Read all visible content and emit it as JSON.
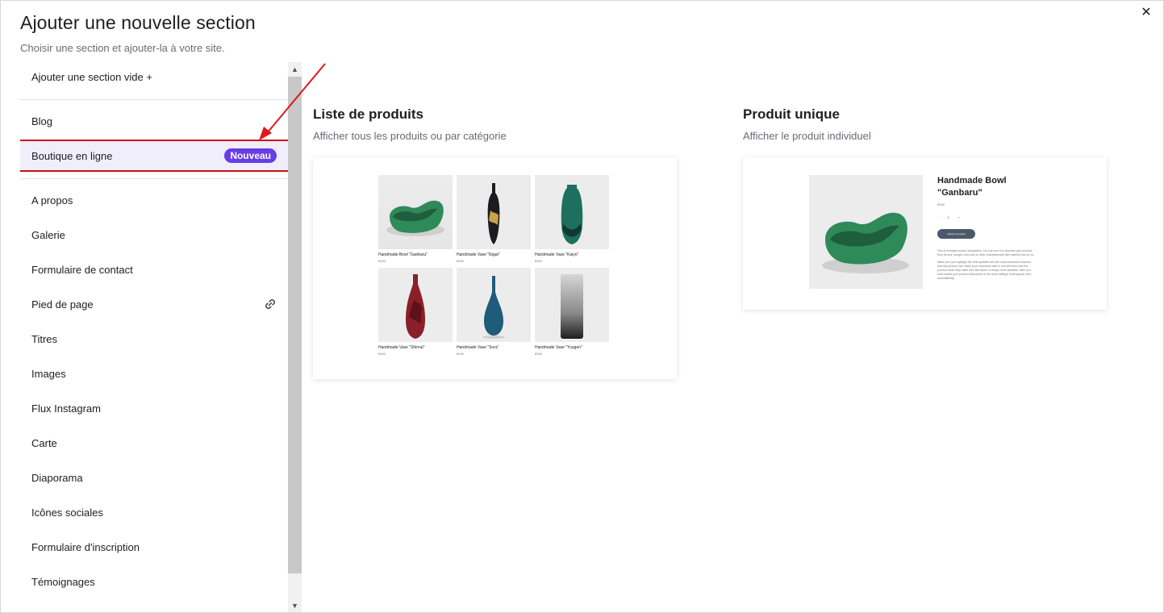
{
  "header": {
    "title": "Ajouter une nouvelle section",
    "subtitle": "Choisir une section et ajouter-la à votre site.",
    "close_glyph": "✕"
  },
  "sidebar": {
    "items": [
      {
        "label": "Ajouter une section vide +"
      },
      {
        "label": "Blog"
      },
      {
        "label": "Boutique en ligne",
        "badge": "Nouveau",
        "selected": true
      },
      {
        "label": "A propos"
      },
      {
        "label": "Galerie"
      },
      {
        "label": "Formulaire de contact"
      },
      {
        "label": "Pied de page",
        "icon": "link-icon"
      },
      {
        "label": "Titres"
      },
      {
        "label": "Images"
      },
      {
        "label": "Flux Instagram"
      },
      {
        "label": "Carte"
      },
      {
        "label": "Diaporama"
      },
      {
        "label": "Icônes sociales"
      },
      {
        "label": "Formulaire d'inscription"
      },
      {
        "label": "Témoignages"
      }
    ]
  },
  "scrollbar": {
    "up_glyph": "▲",
    "down_glyph": "▼"
  },
  "main": {
    "cards": [
      {
        "title": "Liste de produits",
        "description": "Afficher tous les produits ou par catégorie",
        "products": [
          {
            "name": "Handmade Bowl \"Ganbaru\"",
            "price": "€000"
          },
          {
            "name": "Handmade Vase \"Ikigai\"",
            "price": "€000"
          },
          {
            "name": "Handmade Vase \"Kaiyo\"",
            "price": "€000"
          },
          {
            "name": "Handmade Vase \"Shinrai\"",
            "price": "€000"
          },
          {
            "name": "Handmade Vase \"Sora\"",
            "price": "€000"
          },
          {
            "name": "Handmade Vase \"Yuugen\"",
            "price": "€000"
          }
        ]
      },
      {
        "title": "Produit unique",
        "description": "Afficher le produit individuel",
        "product_title": "Handmade Bowl \"Ganbaru\"",
        "price": "€000",
        "quantity": "- 1 +",
        "button_label": "Ajouter au panier",
        "text_1": "This is example product description. You can use it to describe your product, from its size, weight, and color to other characteristics like material and so on.",
        "text_2": "Make sure you highlight the best qualities and the most important functions that this product has. Make your customers want it and tell them how the product could help make their life easier or simply more beautiful. After you have added your product description in the store settings it will appear here automatically."
      }
    ]
  },
  "colors": {
    "accent": "#673de6",
    "highlight_border": "#d10e0e",
    "arrow": "#e01818"
  }
}
